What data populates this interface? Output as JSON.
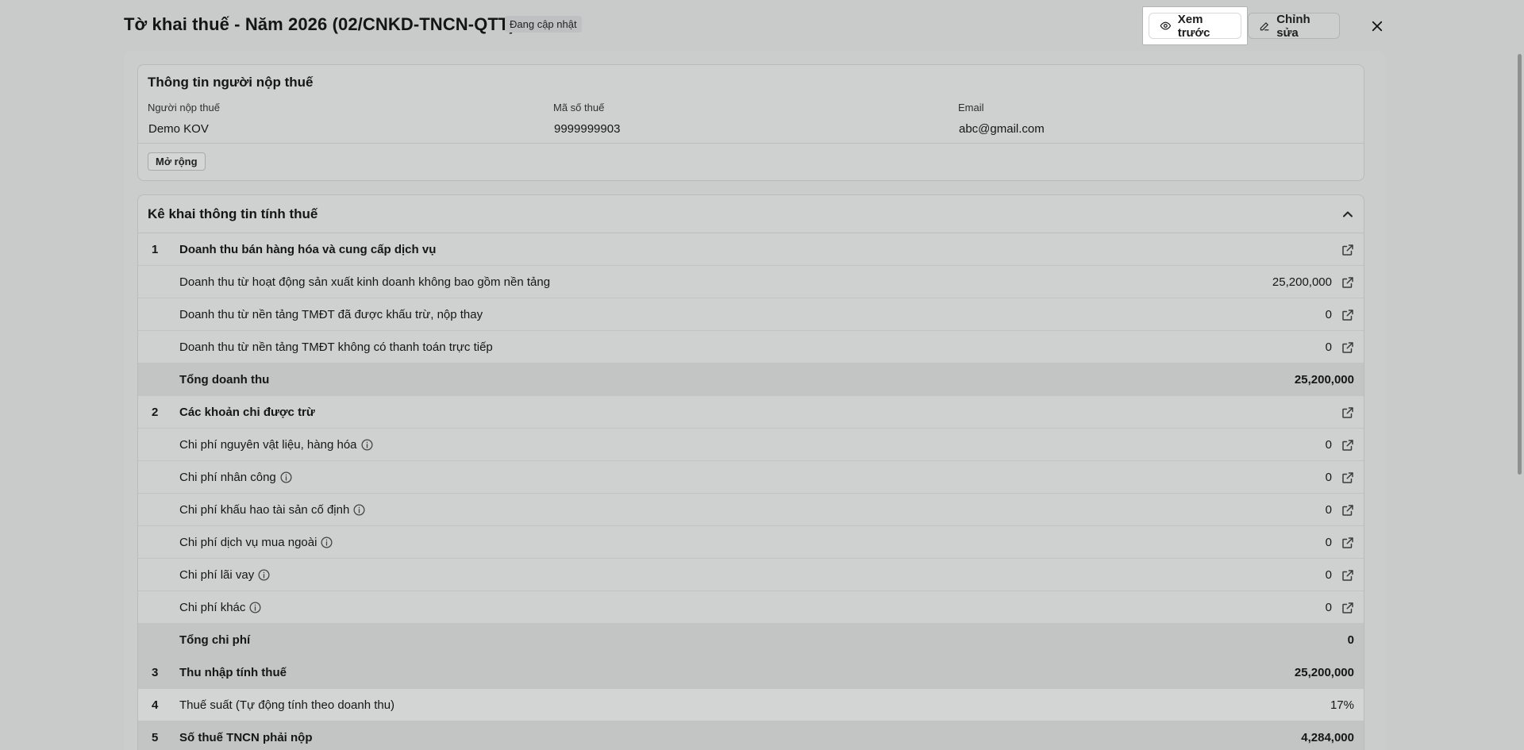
{
  "header": {
    "title": "Tờ khai thuế - Năm 2026 (02/CNKD-TNCN-QTT)",
    "status_badge": "Đang cập nhật",
    "preview_label": "Xem trước",
    "edit_label": "Chỉnh sửa"
  },
  "taxpayer": {
    "section_title": "Thông tin người nộp thuế",
    "fields": [
      {
        "label": "Người nộp thuế",
        "value": "Demo KOV"
      },
      {
        "label": "Mã số thuế",
        "value": "9999999903"
      },
      {
        "label": "Email",
        "value": "abc@gmail.com"
      }
    ],
    "expand_label": "Mở rộng"
  },
  "calc": {
    "section_title": "Kê khai thông tin tính thuế",
    "rows": [
      {
        "num": "1",
        "label": "Doanh thu bán hàng hóa và cung cấp dịch vụ",
        "value": "",
        "bold": true,
        "total": false,
        "link": true,
        "info": false
      },
      {
        "num": "",
        "label": "Doanh thu từ hoạt động sản xuất kinh doanh không bao gồm nền tảng",
        "value": "25,200,000",
        "bold": false,
        "total": false,
        "link": true,
        "info": false
      },
      {
        "num": "",
        "label": "Doanh thu từ nền tảng TMĐT đã được khấu trừ, nộp thay",
        "value": "0",
        "bold": false,
        "total": false,
        "link": true,
        "info": false
      },
      {
        "num": "",
        "label": "Doanh thu từ nền tảng TMĐT không có thanh toán trực tiếp",
        "value": "0",
        "bold": false,
        "total": false,
        "link": true,
        "info": false
      },
      {
        "num": "",
        "label": "Tổng doanh thu",
        "value": "25,200,000",
        "bold": true,
        "total": true,
        "link": false,
        "info": false
      },
      {
        "num": "2",
        "label": "Các khoản chi được trừ",
        "value": "",
        "bold": true,
        "total": false,
        "link": true,
        "info": false
      },
      {
        "num": "",
        "label": "Chi phí nguyên vật liệu, hàng hóa",
        "value": "0",
        "bold": false,
        "total": false,
        "link": true,
        "info": true
      },
      {
        "num": "",
        "label": "Chi phí nhân công",
        "value": "0",
        "bold": false,
        "total": false,
        "link": true,
        "info": true
      },
      {
        "num": "",
        "label": "Chi phí khấu hao tài sản cố định",
        "value": "0",
        "bold": false,
        "total": false,
        "link": true,
        "info": true
      },
      {
        "num": "",
        "label": "Chi phí dịch vụ mua ngoài",
        "value": "0",
        "bold": false,
        "total": false,
        "link": true,
        "info": true
      },
      {
        "num": "",
        "label": "Chi phí lãi vay",
        "value": "0",
        "bold": false,
        "total": false,
        "link": true,
        "info": true
      },
      {
        "num": "",
        "label": "Chi phí khác",
        "value": "0",
        "bold": false,
        "total": false,
        "link": true,
        "info": true
      },
      {
        "num": "",
        "label": "Tổng chi phí",
        "value": "0",
        "bold": true,
        "total": true,
        "link": false,
        "info": false
      },
      {
        "num": "3",
        "label": "Thu nhập tính thuế",
        "value": "25,200,000",
        "bold": true,
        "total": true,
        "link": false,
        "info": false
      },
      {
        "num": "4",
        "label": "Thuế suất (Tự động tính theo doanh thu)",
        "value": "17%",
        "bold": false,
        "total": false,
        "alt": true,
        "link": false,
        "info": false
      },
      {
        "num": "5",
        "label": "Số thuế TNCN phải nộp",
        "value": "4,284,000",
        "bold": true,
        "total": true,
        "link": false,
        "info": false
      }
    ]
  },
  "icons": {
    "preview": "eye-icon",
    "edit": "pencil-icon",
    "close": "close-icon",
    "collapse": "chevron-up-icon",
    "row_link": "external-link-icon",
    "row_info": "info-icon"
  }
}
